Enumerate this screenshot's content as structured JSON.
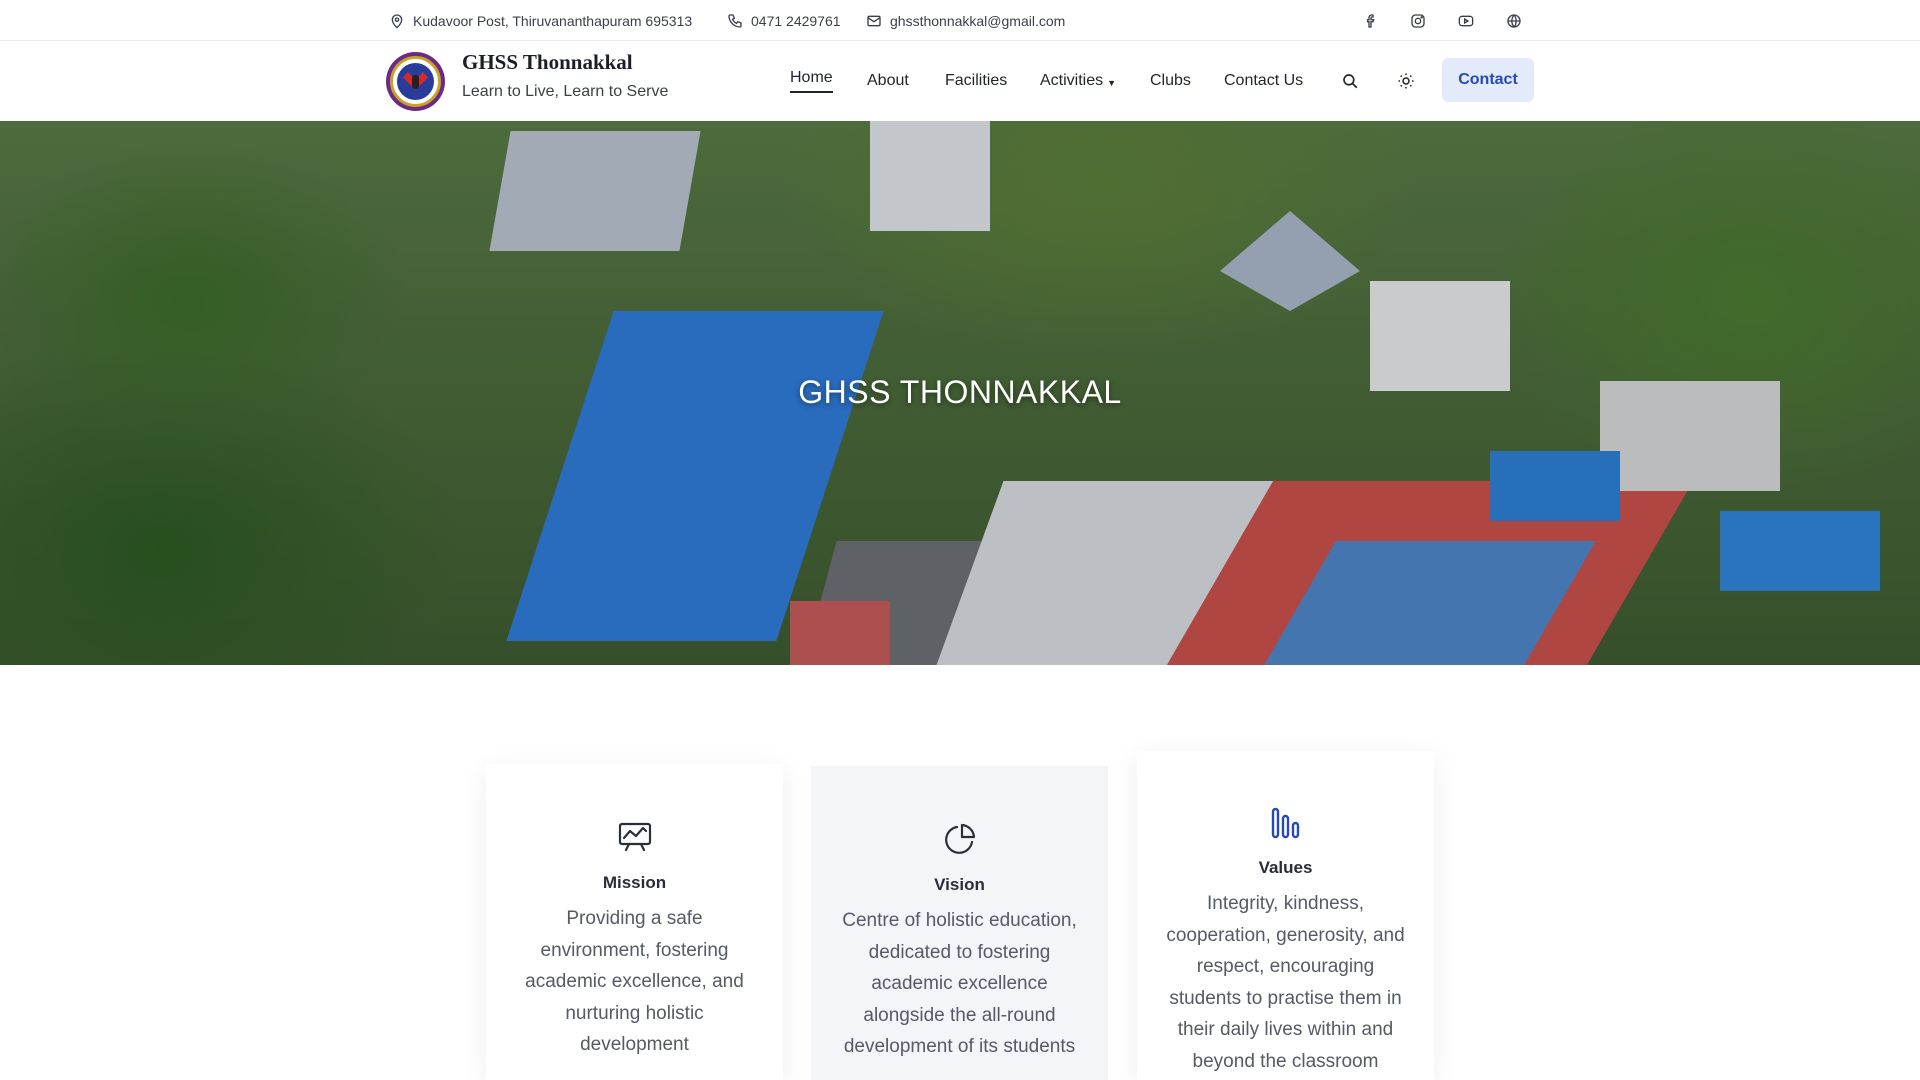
{
  "topbar": {
    "address": "Kudavoor Post, Thiruvananthapuram 695313",
    "phone": "0471 2429761",
    "email": "ghssthonnakkal@gmail.com",
    "icons": [
      "map-pin-icon",
      "phone-icon",
      "mail-icon"
    ],
    "social": [
      "facebook-icon",
      "instagram-icon",
      "youtube-icon",
      "globe-icon"
    ]
  },
  "header": {
    "title": "GHSS Thonnakkal",
    "tagline": "Learn to Live, Learn to Serve",
    "nav": [
      {
        "label": "Home",
        "active": true
      },
      {
        "label": "About"
      },
      {
        "label": "Facilities"
      },
      {
        "label": "Activities",
        "has_dropdown": true
      },
      {
        "label": "Clubs"
      },
      {
        "label": "Contact Us"
      }
    ],
    "contact_button": "Contact",
    "accent": "#2649b8",
    "contact_button_bg": "#e3ebfb"
  },
  "hero": {
    "title": "GHSS THONNAKKAL"
  },
  "cards": [
    {
      "title": "Mission",
      "icon": "presentation-chart-icon",
      "text": "Providing a safe environment, fostering academic excellence, and nurturing holistic development"
    },
    {
      "title": "Vision",
      "icon": "pie-chart-icon",
      "text": "Centre of holistic education, dedicated to fostering academic excellence alongside the all-round development of its students"
    },
    {
      "title": "Values",
      "icon": "bar-chart-icon",
      "text": "Integrity, kindness, cooperation, generosity, and respect, encouraging students to practise them in their daily lives within and beyond the classroom",
      "icon_color": "#2649b8"
    }
  ]
}
